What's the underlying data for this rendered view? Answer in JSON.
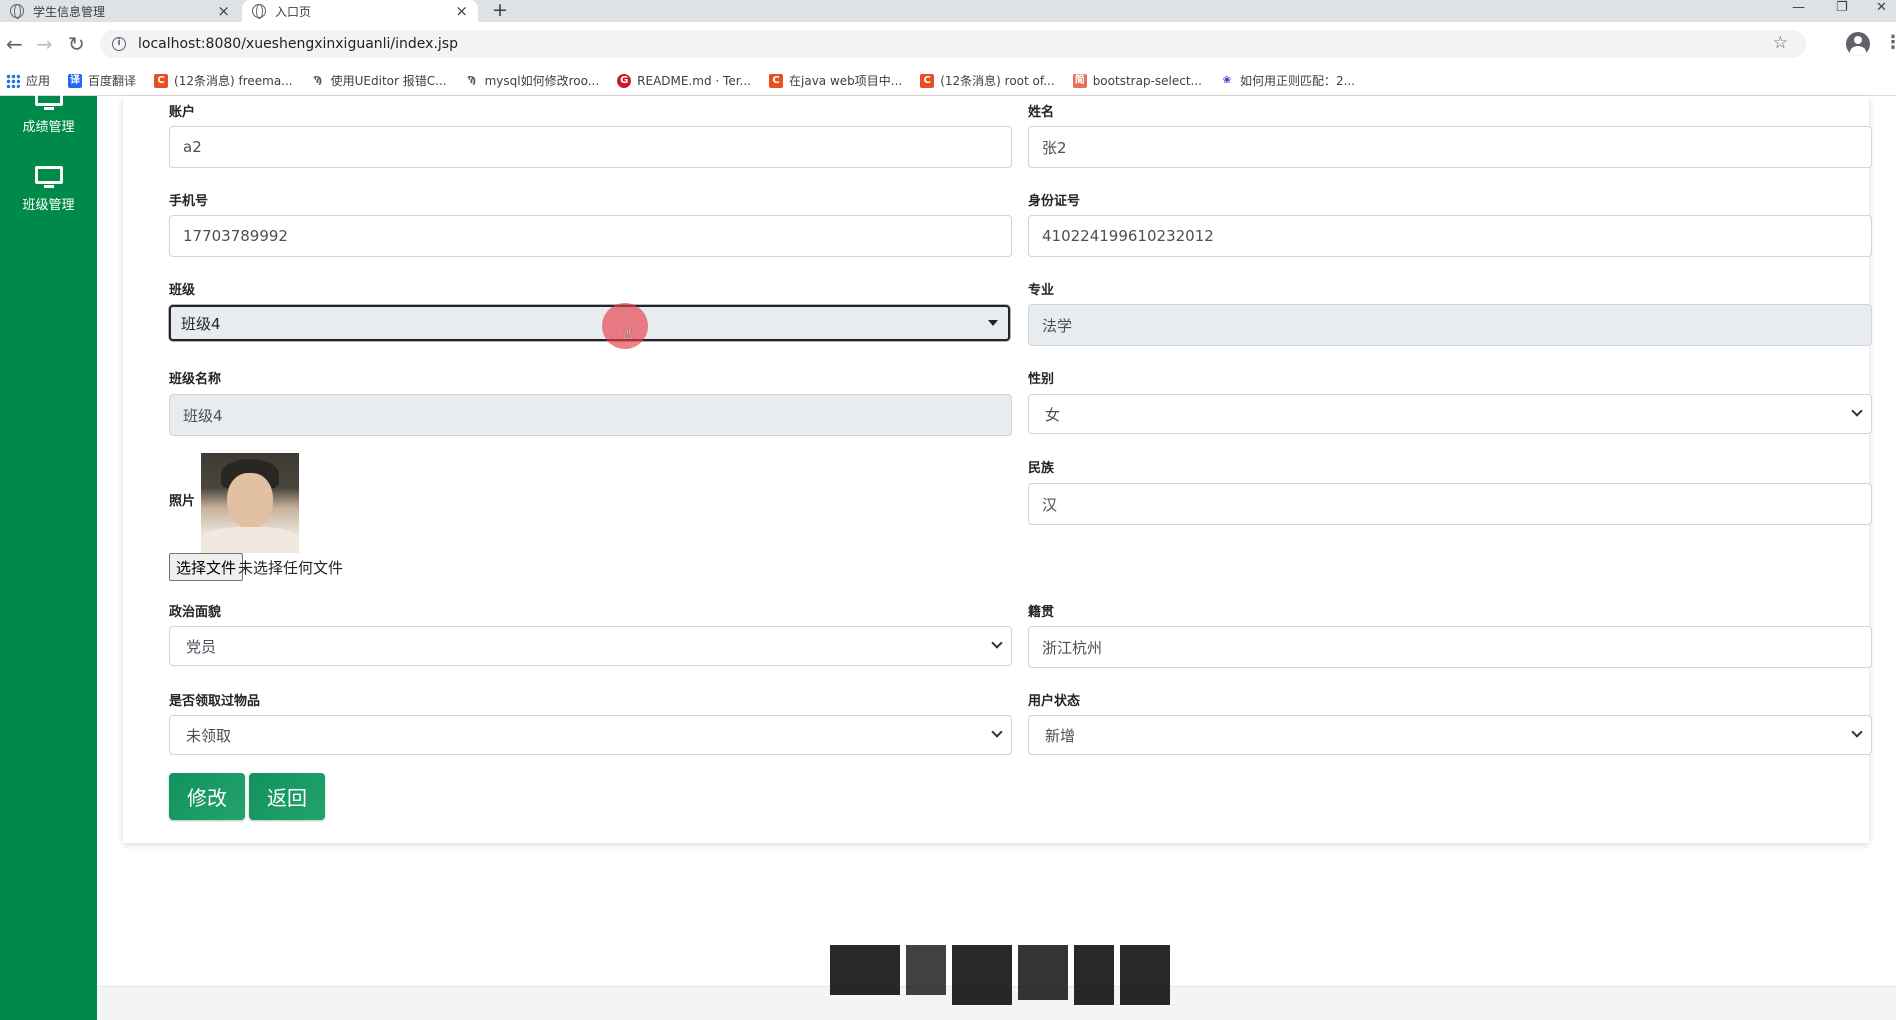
{
  "browser": {
    "tabs": [
      {
        "title": "学生信息管理",
        "active": false
      },
      {
        "title": "入口页",
        "active": true
      }
    ],
    "new_tab": "+",
    "window_controls": [
      "—",
      "❐",
      "✕"
    ],
    "url": "localhost:8080/xueshengxinxiguanli/index.jsp",
    "bookmarks": [
      {
        "label": "应用",
        "icon": "apps-grid-icon",
        "color": "#1a73e8"
      },
      {
        "label": "百度翻译",
        "icon": "baidu-translate-icon",
        "color": "#2468f2"
      },
      {
        "label": "(12条消息) freema...",
        "icon": "csdn-icon",
        "color": "#e8501e"
      },
      {
        "label": "使用UEditor 报错C...",
        "icon": "ueditor-icon",
        "color": "#555555"
      },
      {
        "label": "mysql如何修改roo...",
        "icon": "mysql-icon",
        "color": "#555555"
      },
      {
        "label": "README.md · Ter...",
        "icon": "gitee-icon",
        "color": "#c71d23"
      },
      {
        "label": "在java web项目中...",
        "icon": "csdn-icon",
        "color": "#e8501e"
      },
      {
        "label": "(12条消息) root of...",
        "icon": "csdn-icon",
        "color": "#e8501e"
      },
      {
        "label": "bootstrap-select...",
        "icon": "jianshu-icon",
        "color": "#ea6f5a"
      },
      {
        "label": "如何用正则匹配：2...",
        "icon": "baidu-paw-icon",
        "color": "#2932e1"
      }
    ]
  },
  "sidebar": {
    "items": [
      {
        "label": "成绩管理"
      },
      {
        "label": "班级管理"
      }
    ],
    "color": "#008a49"
  },
  "form": {
    "account": {
      "label": "账户",
      "value": "a2"
    },
    "name": {
      "label": "姓名",
      "value": "张2"
    },
    "phone": {
      "label": "手机号",
      "value": "17703789992"
    },
    "id_card": {
      "label": "身份证号",
      "value": "410224199610232012"
    },
    "class": {
      "label": "班级",
      "value": "班级4"
    },
    "major": {
      "label": "专业",
      "value": "法学"
    },
    "class_name": {
      "label": "班级名称",
      "value": "班级4"
    },
    "gender": {
      "label": "性别",
      "value": "女"
    },
    "photo": {
      "label": "照片",
      "button": "选择文件",
      "file_status": "未选择任何文件"
    },
    "ethnicity": {
      "label": "民族",
      "value": "汉"
    },
    "political": {
      "label": "政治面貌",
      "value": "党员"
    },
    "origin": {
      "label": "籍贯",
      "value": "浙江杭州"
    },
    "received": {
      "label": "是否领取过物品",
      "value": "未领取"
    },
    "status": {
      "label": "用户状态",
      "value": "新增"
    }
  },
  "actions": {
    "modify": "修改",
    "back": "返回",
    "color": "#14965f"
  }
}
